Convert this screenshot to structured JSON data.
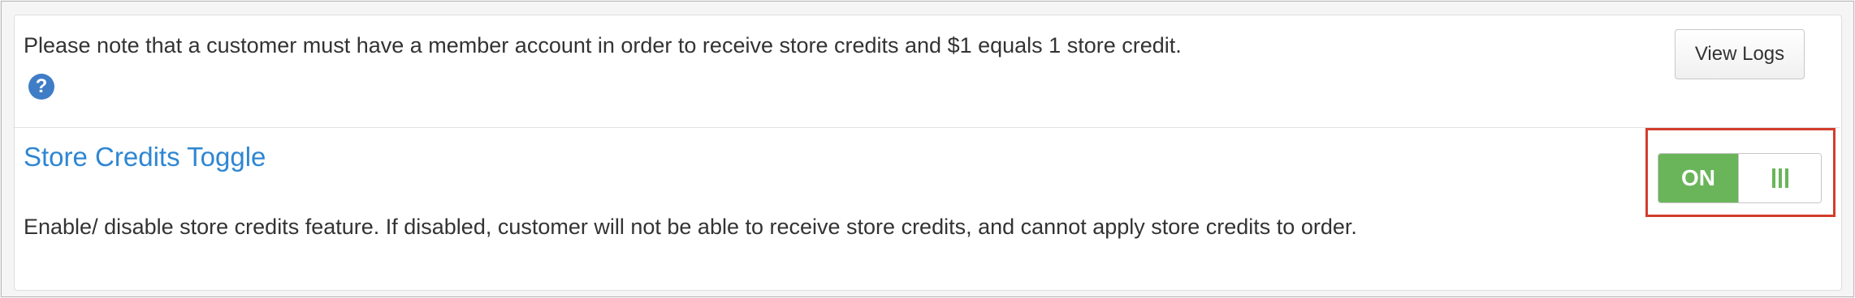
{
  "notice": {
    "text": "Please note that a customer must have a member account in order to receive store credits and $1 equals 1 store credit.",
    "help_glyph": "?"
  },
  "view_logs_label": "View Logs",
  "store_credits": {
    "title": "Store Credits Toggle",
    "description": "Enable/ disable store credits feature. If disabled, customer will not be able to receive store credits, and cannot apply store credits to order.",
    "toggle_state_label": "ON",
    "toggle_on": true
  },
  "colors": {
    "accent": "#2f86d2",
    "toggle_on": "#6ab55a",
    "highlight": "#d33d2c"
  }
}
